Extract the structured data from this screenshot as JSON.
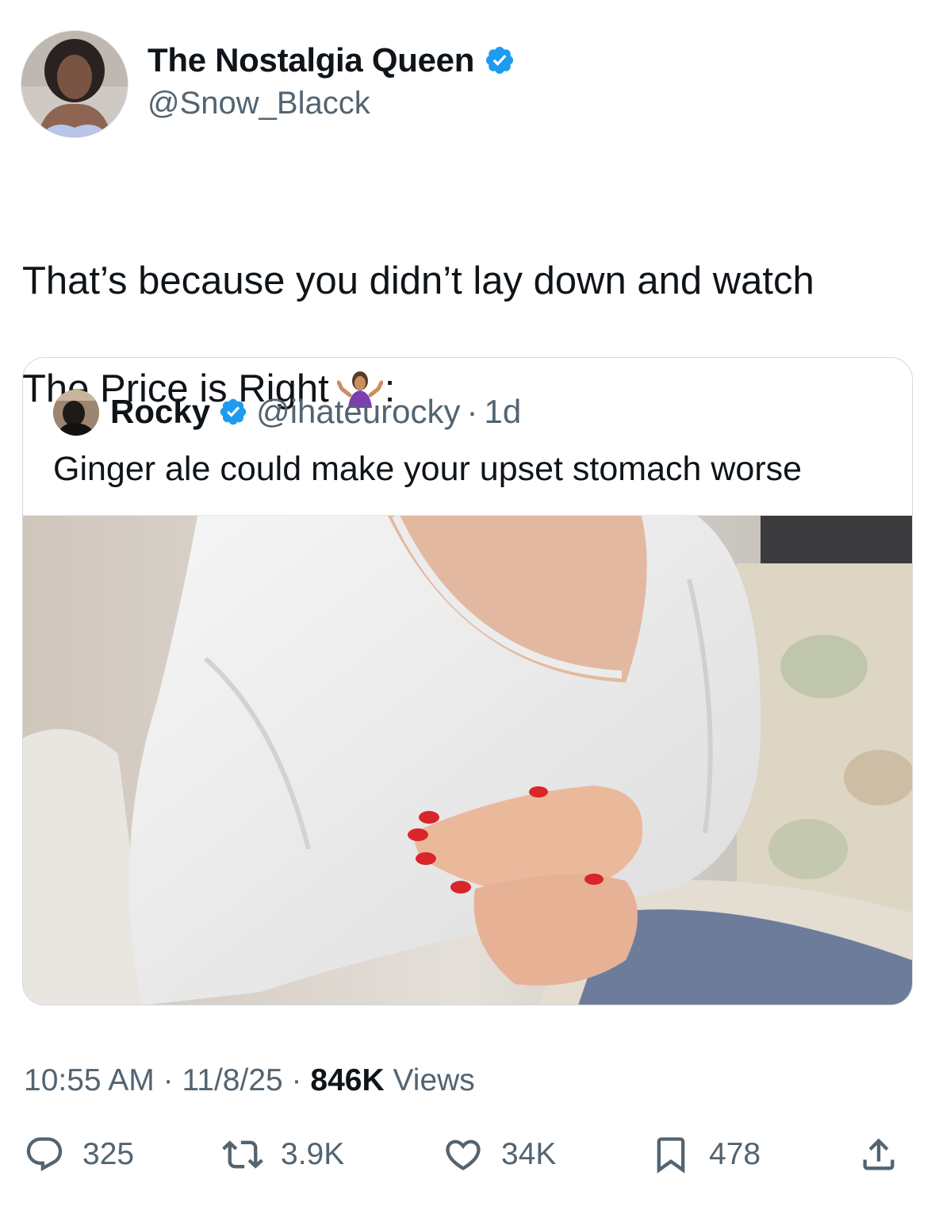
{
  "author": {
    "display_name": "The Nostalgia Queen",
    "handle": "@Snow_Blacck",
    "verified": true
  },
  "tweet": {
    "text_line1": "That’s because you didn’t lay down and watch",
    "text_line2_before_emoji": "The Price is Right",
    "text_line2_after_emoji": ":",
    "emoji": "person-shrugging-emoji"
  },
  "quoted_tweet": {
    "display_name": "Rocky",
    "handle": "@ihateurocky",
    "separator": "·",
    "age": "1d",
    "text": "Ginger ale could make your upset stomach worse",
    "image": "woman-holding-stomach-photo"
  },
  "meta": {
    "time": "10:55 AM",
    "date": "11/8/25",
    "views_count": "846K",
    "views_label": "Views",
    "separator": "·"
  },
  "actions": {
    "replies": "325",
    "reposts": "3.9K",
    "likes": "34K",
    "bookmarks": "478"
  },
  "colors": {
    "verified_blue": "#1d9bf0",
    "secondary_text": "#536471",
    "primary_text": "#0f1419",
    "border": "#cfd9de"
  }
}
